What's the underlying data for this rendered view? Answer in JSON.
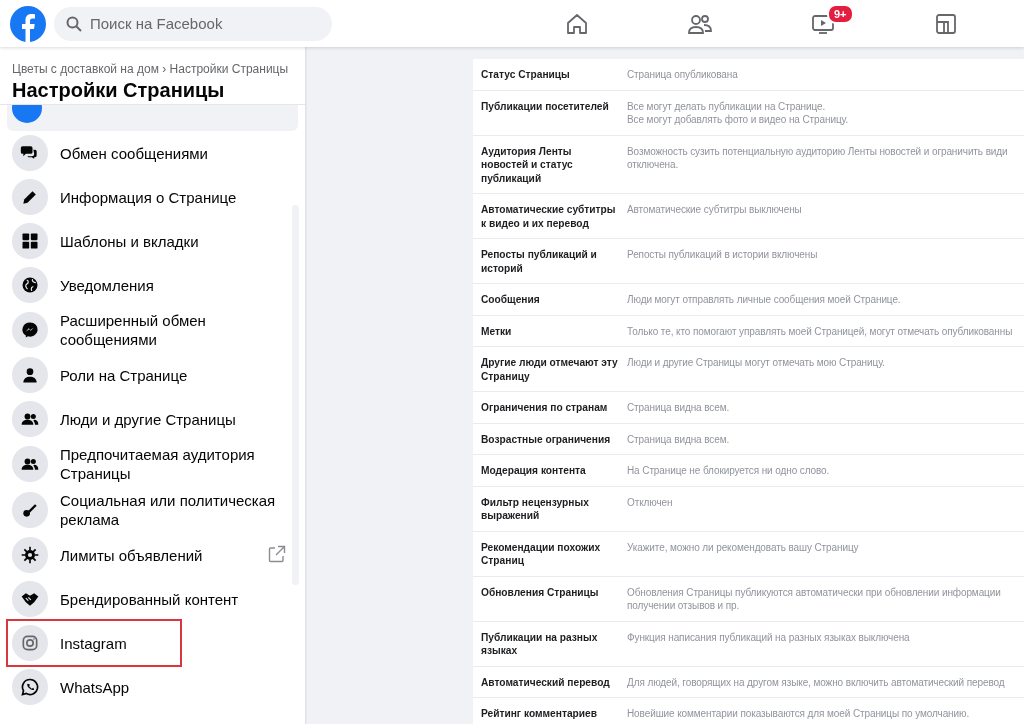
{
  "topbar": {
    "search": {
      "placeholder": "Поиск на Facebook"
    },
    "nav": [
      {
        "kind": "home",
        "selected": false
      },
      {
        "kind": "friends",
        "selected": false
      },
      {
        "kind": "video",
        "selected": false,
        "badge": "9+"
      },
      {
        "kind": "gaming",
        "selected": false
      }
    ]
  },
  "sidebar": {
    "breadcrumb": "Цветы с доставкой на дом › Настройки Страницы",
    "title": "Настройки Страницы",
    "items": [
      {
        "label": "Обмен сообщениями",
        "external_link": false,
        "highlighted": false
      },
      {
        "label": "Информация о Странице",
        "external_link": false,
        "highlighted": false
      },
      {
        "label": "Шаблоны и вкладки",
        "external_link": false,
        "highlighted": false
      },
      {
        "label": "Уведомления",
        "external_link": false,
        "highlighted": false
      },
      {
        "label": "Расширенный обмен сообщениями",
        "external_link": false,
        "highlighted": false
      },
      {
        "label": "Роли на Странице",
        "external_link": false,
        "highlighted": false
      },
      {
        "label": "Люди и другие Страницы",
        "external_link": false,
        "highlighted": false
      },
      {
        "label": "Предпочитаемая аудитория Страницы",
        "external_link": false,
        "highlighted": false
      },
      {
        "label": "Социальная или политическая реклама",
        "external_link": false,
        "highlighted": false
      },
      {
        "label": "Лимиты объявлений",
        "external_link": true,
        "highlighted": false
      },
      {
        "label": "Брендированный контент",
        "external_link": false,
        "highlighted": false
      },
      {
        "label": "Instagram",
        "external_link": false,
        "highlighted": true
      },
      {
        "label": "WhatsApp",
        "external_link": false,
        "highlighted": false
      }
    ]
  },
  "settings": [
    {
      "name": "Статус Страницы",
      "value": [
        "Страница опубликована"
      ]
    },
    {
      "name": "Публикации посетителей",
      "value": [
        "Все могут делать публикации на Странице.",
        "Все могут добавлять фото и видео на Страницу."
      ]
    },
    {
      "name": "Аудитория Ленты новостей и статус публикаций",
      "value": [
        "Возможность сузить потенциальную аудиторию Ленты новостей и ограничить види",
        "отключена."
      ]
    },
    {
      "name": "Автоматические субтитры к видео и их перевод",
      "value": [
        "Автоматические субтитры выключены"
      ]
    },
    {
      "name": "Репосты публикаций и историй",
      "value": [
        "Репосты публикаций в истории включены"
      ]
    },
    {
      "name": "Сообщения",
      "value": [
        "Люди могут отправлять личные сообщения моей Странице."
      ]
    },
    {
      "name": "Метки",
      "value": [
        "Только те, кто помогают управлять моей Страницей, могут отмечать опубликованны"
      ]
    },
    {
      "name": "Другие люди отмечают эту Страницу",
      "value": [
        "Люди и другие Страницы могут отмечать мою Страницу."
      ]
    },
    {
      "name": "Ограничения по странам",
      "value": [
        "Страница видна всем."
      ]
    },
    {
      "name": "Возрастные ограничения",
      "value": [
        "Страница видна всем."
      ]
    },
    {
      "name": "Модерация контента",
      "value": [
        "На Странице не блокируется ни одно слово."
      ]
    },
    {
      "name": "Фильтр нецензурных выражений",
      "value": [
        "Отключен"
      ]
    },
    {
      "name": "Рекомендации похожих Страниц",
      "value": [
        "Укажите, можно ли рекомендовать вашу Страницу"
      ]
    },
    {
      "name": "Обновления Страницы",
      "value": [
        "Обновления Страницы публикуются автоматически при обновлении информации",
        "получении отзывов и пр."
      ]
    },
    {
      "name": "Публикации на разных языках",
      "value": [
        "Функция написания публикаций на разных языках выключена"
      ]
    },
    {
      "name": "Автоматический перевод",
      "value": [
        "Для людей, говорящих на другом языке, можно включить автоматический перевод"
      ]
    },
    {
      "name": "Рейтинг комментариев",
      "value": [
        "Новейшие комментарии показываются для моей Страницы по умолчанию."
      ]
    }
  ]
}
